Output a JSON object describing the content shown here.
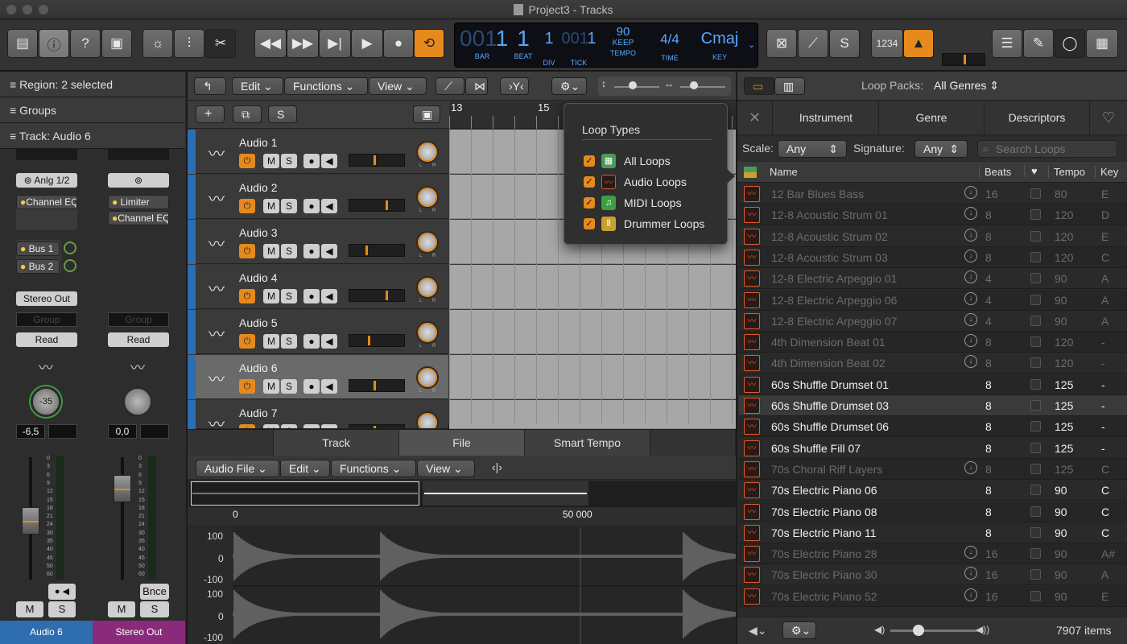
{
  "window": {
    "title": "Project3 - Tracks"
  },
  "lcd": {
    "bar": "001",
    "bar_val": "1",
    "beat": "1",
    "div": "1",
    "tick": "001",
    "tick_val": "1",
    "tempo": "90",
    "tempo_sub": "KEEP",
    "sig": "4/4",
    "key": "Cmaj",
    "labels": {
      "bar": "BAR",
      "beat": "BEAT",
      "div": "DIV",
      "tick": "TICK",
      "tempo": "TEMPO",
      "time": "TIME",
      "key": "KEY"
    }
  },
  "toolbar": {
    "count_in": "1234"
  },
  "inspector": {
    "region": "Region: 2 selected",
    "groups": "Groups",
    "track": "Track: Audio 6"
  },
  "mixer": {
    "left": {
      "input": "Anlg 1/2",
      "plugin": "Channel EQ",
      "bus1": "Bus 1",
      "bus2": "Bus 2",
      "output": "Stereo Out",
      "group": "Group",
      "auto": "Read",
      "pan": "-35",
      "vol": "-6,5",
      "mute": "M",
      "solo": "S",
      "name": "Audio 6"
    },
    "right": {
      "plugin1": "Limiter",
      "plugin2": "Channel EQ",
      "group": "Group",
      "auto": "Read",
      "vol": "0,0",
      "bnce": "Bnce",
      "mute": "M",
      "solo": "S",
      "name": "Stereo Out"
    },
    "scale": [
      "0",
      "3",
      "6",
      "9",
      "12",
      "15",
      "18",
      "21",
      "24",
      "30",
      "35",
      "40",
      "45",
      "50",
      "60"
    ]
  },
  "tracks_menu": {
    "edit": "Edit",
    "functions": "Functions",
    "view": "View"
  },
  "track_header": {
    "solo": "S"
  },
  "ruler": {
    "m13": "13",
    "m15": "15"
  },
  "tracks": [
    {
      "name": "Audio 1",
      "vol": 0.45
    },
    {
      "name": "Audio 2",
      "vol": 0.68
    },
    {
      "name": "Audio 3",
      "vol": 0.3
    },
    {
      "name": "Audio 4",
      "vol": 0.68
    },
    {
      "name": "Audio 5",
      "vol": 0.35
    },
    {
      "name": "Audio 6",
      "vol": 0.45
    },
    {
      "name": "Audio 7",
      "vol": 0.45
    }
  ],
  "track_btn": {
    "mute": "M",
    "solo": "S",
    "knob_l": "L",
    "knob_r": "R"
  },
  "editor": {
    "tabs": [
      "Track",
      "File",
      "Smart Tempo"
    ],
    "menus": {
      "audio_file": "Audio File",
      "edit": "Edit",
      "functions": "Functions",
      "view": "View"
    },
    "ruler_0": "0",
    "ruler_50k": "50 000",
    "y_top": [
      "100",
      "0",
      "-100"
    ],
    "y_bot": [
      "100",
      "0",
      "-100"
    ]
  },
  "loop_types": {
    "title": "Loop Types",
    "items": [
      {
        "label": "All Loops",
        "color": "#4a9a58"
      },
      {
        "label": "Audio Loops",
        "color": "#d85a2a"
      },
      {
        "label": "MIDI Loops",
        "color": "#3aa040"
      },
      {
        "label": "Drummer Loops",
        "color": "#c8a030"
      }
    ]
  },
  "browser": {
    "loop_packs_label": "Loop Packs:",
    "loop_packs_value": "All Genres",
    "tabs": [
      "Instrument",
      "Genre",
      "Descriptors"
    ],
    "scale_label": "Scale:",
    "scale_value": "Any",
    "signature_label": "Signature:",
    "signature_value": "Any",
    "search_placeholder": "Search Loops",
    "cols": {
      "name": "Name",
      "beats": "Beats",
      "tempo": "Tempo",
      "key": "Key"
    },
    "items_count": "7907 items",
    "loops": [
      {
        "name": "12 Bar Blues Bass",
        "beats": "16",
        "tempo": "80",
        "key": "E",
        "dl": true
      },
      {
        "name": "12-8 Acoustic Strum 01",
        "beats": "8",
        "tempo": "120",
        "key": "D",
        "dl": true
      },
      {
        "name": "12-8 Acoustic Strum 02",
        "beats": "8",
        "tempo": "120",
        "key": "E",
        "dl": true
      },
      {
        "name": "12-8 Acoustic Strum 03",
        "beats": "8",
        "tempo": "120",
        "key": "C",
        "dl": true
      },
      {
        "name": "12-8 Electric Arpeggio 01",
        "beats": "4",
        "tempo": "90",
        "key": "A",
        "dl": true
      },
      {
        "name": "12-8 Electric Arpeggio 06",
        "beats": "4",
        "tempo": "90",
        "key": "A",
        "dl": true
      },
      {
        "name": "12-8 Electric Arpeggio 07",
        "beats": "4",
        "tempo": "90",
        "key": "A",
        "dl": true
      },
      {
        "name": "4th Dimension Beat 01",
        "beats": "8",
        "tempo": "120",
        "key": "-",
        "dl": true
      },
      {
        "name": "4th Dimension Beat 02",
        "beats": "8",
        "tempo": "120",
        "key": "-",
        "dl": true
      },
      {
        "name": "60s Shuffle Drumset 01",
        "beats": "8",
        "tempo": "125",
        "key": "-",
        "dl": false
      },
      {
        "name": "60s Shuffle Drumset 03",
        "beats": "8",
        "tempo": "125",
        "key": "-",
        "dl": false
      },
      {
        "name": "60s Shuffle Drumset 06",
        "beats": "8",
        "tempo": "125",
        "key": "-",
        "dl": false
      },
      {
        "name": "60s Shuffle Fill 07",
        "beats": "8",
        "tempo": "125",
        "key": "-",
        "dl": false
      },
      {
        "name": "70s Choral Riff Layers",
        "beats": "8",
        "tempo": "125",
        "key": "C",
        "dl": true
      },
      {
        "name": "70s Electric Piano 06",
        "beats": "8",
        "tempo": "90",
        "key": "C",
        "dl": false
      },
      {
        "name": "70s Electric Piano 08",
        "beats": "8",
        "tempo": "90",
        "key": "C",
        "dl": false
      },
      {
        "name": "70s Electric Piano 11",
        "beats": "8",
        "tempo": "90",
        "key": "C",
        "dl": false
      },
      {
        "name": "70s Electric Piano 28",
        "beats": "16",
        "tempo": "90",
        "key": "A#",
        "dl": true
      },
      {
        "name": "70s Electric Piano 30",
        "beats": "16",
        "tempo": "90",
        "key": "A",
        "dl": true
      },
      {
        "name": "70s Electric Piano 52",
        "beats": "16",
        "tempo": "90",
        "key": "E",
        "dl": true
      }
    ]
  },
  "colors": {
    "accent": "#e68a1d",
    "audio_loop": "#e05a2a",
    "lcd": "#5aa6ff",
    "audio6_strip": "#2d6db0",
    "stereo_strip": "#8a2a7a"
  }
}
